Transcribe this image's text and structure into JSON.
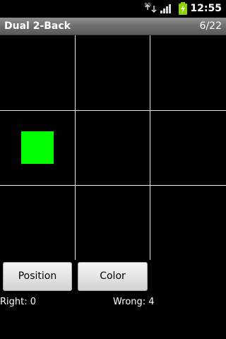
{
  "status_bar": {
    "time": "12:55",
    "network_label": "3G",
    "icons": [
      "data-activity-icon",
      "signal-strength-icon",
      "battery-charging-icon"
    ],
    "colors": {
      "battery": "#8ad100",
      "icon": "#d8d8d8"
    }
  },
  "app": {
    "title": "Dual 2-Back",
    "trial_counter": "6/22"
  },
  "grid": {
    "rows": 3,
    "columns": 3,
    "line_color": "#e8e8e8",
    "stimulus": {
      "row": 2,
      "column": 1,
      "color": "#00ff00"
    }
  },
  "buttons": {
    "position_label": "Position",
    "color_label": "Color"
  },
  "score": {
    "right_label": "Right: 0",
    "wrong_label": "Wrong: 4"
  }
}
